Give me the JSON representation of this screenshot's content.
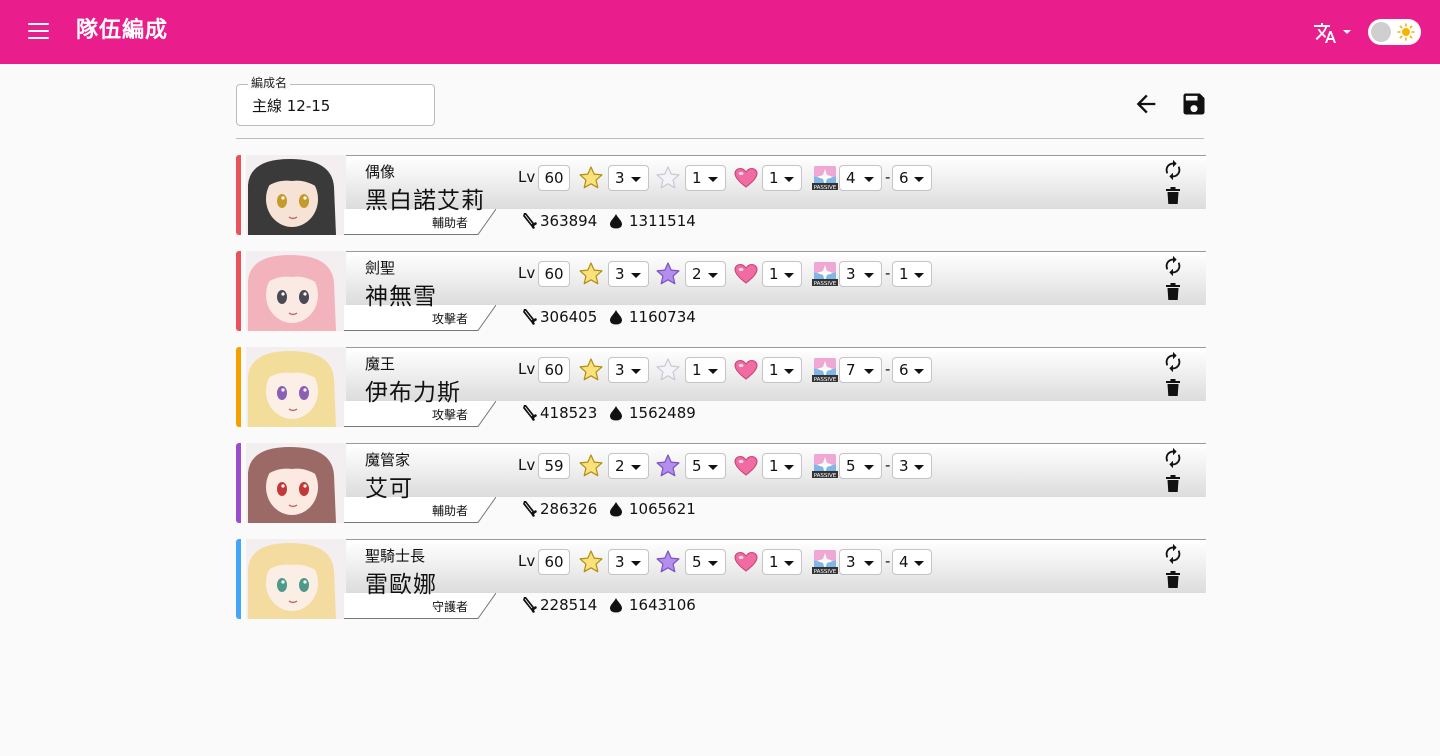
{
  "header": {
    "title": "隊伍編成",
    "menu_icon": "menu-icon",
    "translate_icon": "translate-icon",
    "theme_icon": "sun-icon"
  },
  "form": {
    "label": "編成名",
    "value": "主線 12-15",
    "placeholder": ""
  },
  "toolbar": {
    "back_icon": "arrow-left-icon",
    "save_icon": "save-icon"
  },
  "colors": {
    "appbar": "#e91e8c",
    "attacker": "#e8525a",
    "magic": "#f4a000",
    "support": "#9c4dcc",
    "guardian": "#42a5f5"
  },
  "characters": [
    {
      "title": "偶像",
      "name": "黑白諾艾莉",
      "type": "輔助者",
      "class_color": "#e8525a",
      "level": "60",
      "star": "3",
      "bond_star": "1",
      "favor": "1",
      "passive_a": "4",
      "passive_b": "6",
      "attack": "363894",
      "hp": "1311514",
      "bond_star_filled": false,
      "hair": "#3a3a3a",
      "skin": "#f7e3d6",
      "eyes": "#c49a2c"
    },
    {
      "title": "劍聖",
      "name": "神無雪",
      "type": "攻擊者",
      "class_color": "#e8525a",
      "level": "60",
      "star": "3",
      "bond_star": "2",
      "favor": "1",
      "passive_a": "3",
      "passive_b": "1",
      "attack": "306405",
      "hp": "1160734",
      "bond_star_filled": true,
      "hair": "#f3b3bd",
      "skin": "#fbeae3",
      "eyes": "#4a4a55"
    },
    {
      "title": "魔王",
      "name": "伊布力斯",
      "type": "攻擊者",
      "class_color": "#f4a000",
      "level": "60",
      "star": "3",
      "bond_star": "1",
      "favor": "1",
      "passive_a": "7",
      "passive_b": "6",
      "attack": "418523",
      "hp": "1562489",
      "bond_star_filled": false,
      "hair": "#f3dd9a",
      "skin": "#fbefe6",
      "eyes": "#8a5fb5"
    },
    {
      "title": "魔管家",
      "name": "艾可",
      "type": "輔助者",
      "class_color": "#9c4dcc",
      "level": "59",
      "star": "2",
      "bond_star": "5",
      "favor": "1",
      "passive_a": "5",
      "passive_b": "3",
      "attack": "286326",
      "hp": "1065621",
      "bond_star_filled": true,
      "hair": "#9b6a66",
      "skin": "#fbe9e2",
      "eyes": "#c2393b"
    },
    {
      "title": "聖騎士長",
      "name": "雷歐娜",
      "type": "守護者",
      "class_color": "#42a5f5",
      "level": "60",
      "star": "3",
      "bond_star": "5",
      "favor": "1",
      "passive_a": "3",
      "passive_b": "4",
      "attack": "228514",
      "hp": "1643106",
      "bond_star_filled": true,
      "hair": "#f4dba0",
      "skin": "#fbeee5",
      "eyes": "#4e9a8a"
    }
  ],
  "labels": {
    "level": "Lv",
    "dash": "-"
  },
  "icons": {
    "star": "gold-star-icon",
    "bond_star": "purple-star-icon",
    "favor": "heart-icon",
    "passive": "passive-skill-icon",
    "attack": "sword-icon",
    "hp": "drop-icon",
    "swap": "swap-icon",
    "delete": "trash-icon"
  }
}
